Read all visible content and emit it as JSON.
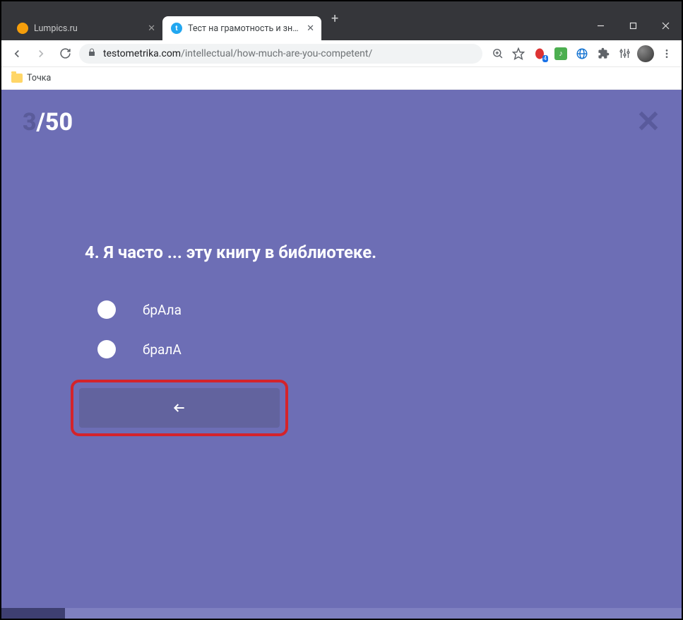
{
  "window": {
    "tabs": [
      {
        "title": "Lumpics.ru",
        "active": false
      },
      {
        "title": "Тест на грамотность и знание р",
        "active": true
      }
    ]
  },
  "addressbar": {
    "domain": "testometrika.com",
    "path": "/intellectual/how-much-are-you-competent/"
  },
  "bookmarks": {
    "item1": "Точка"
  },
  "extension_badge": "4",
  "quiz": {
    "current": "3",
    "separator": "/",
    "total": "50",
    "question": "4. Я часто ... эту книгу в библиотеке.",
    "options": [
      "брАла",
      "бралА"
    ]
  }
}
